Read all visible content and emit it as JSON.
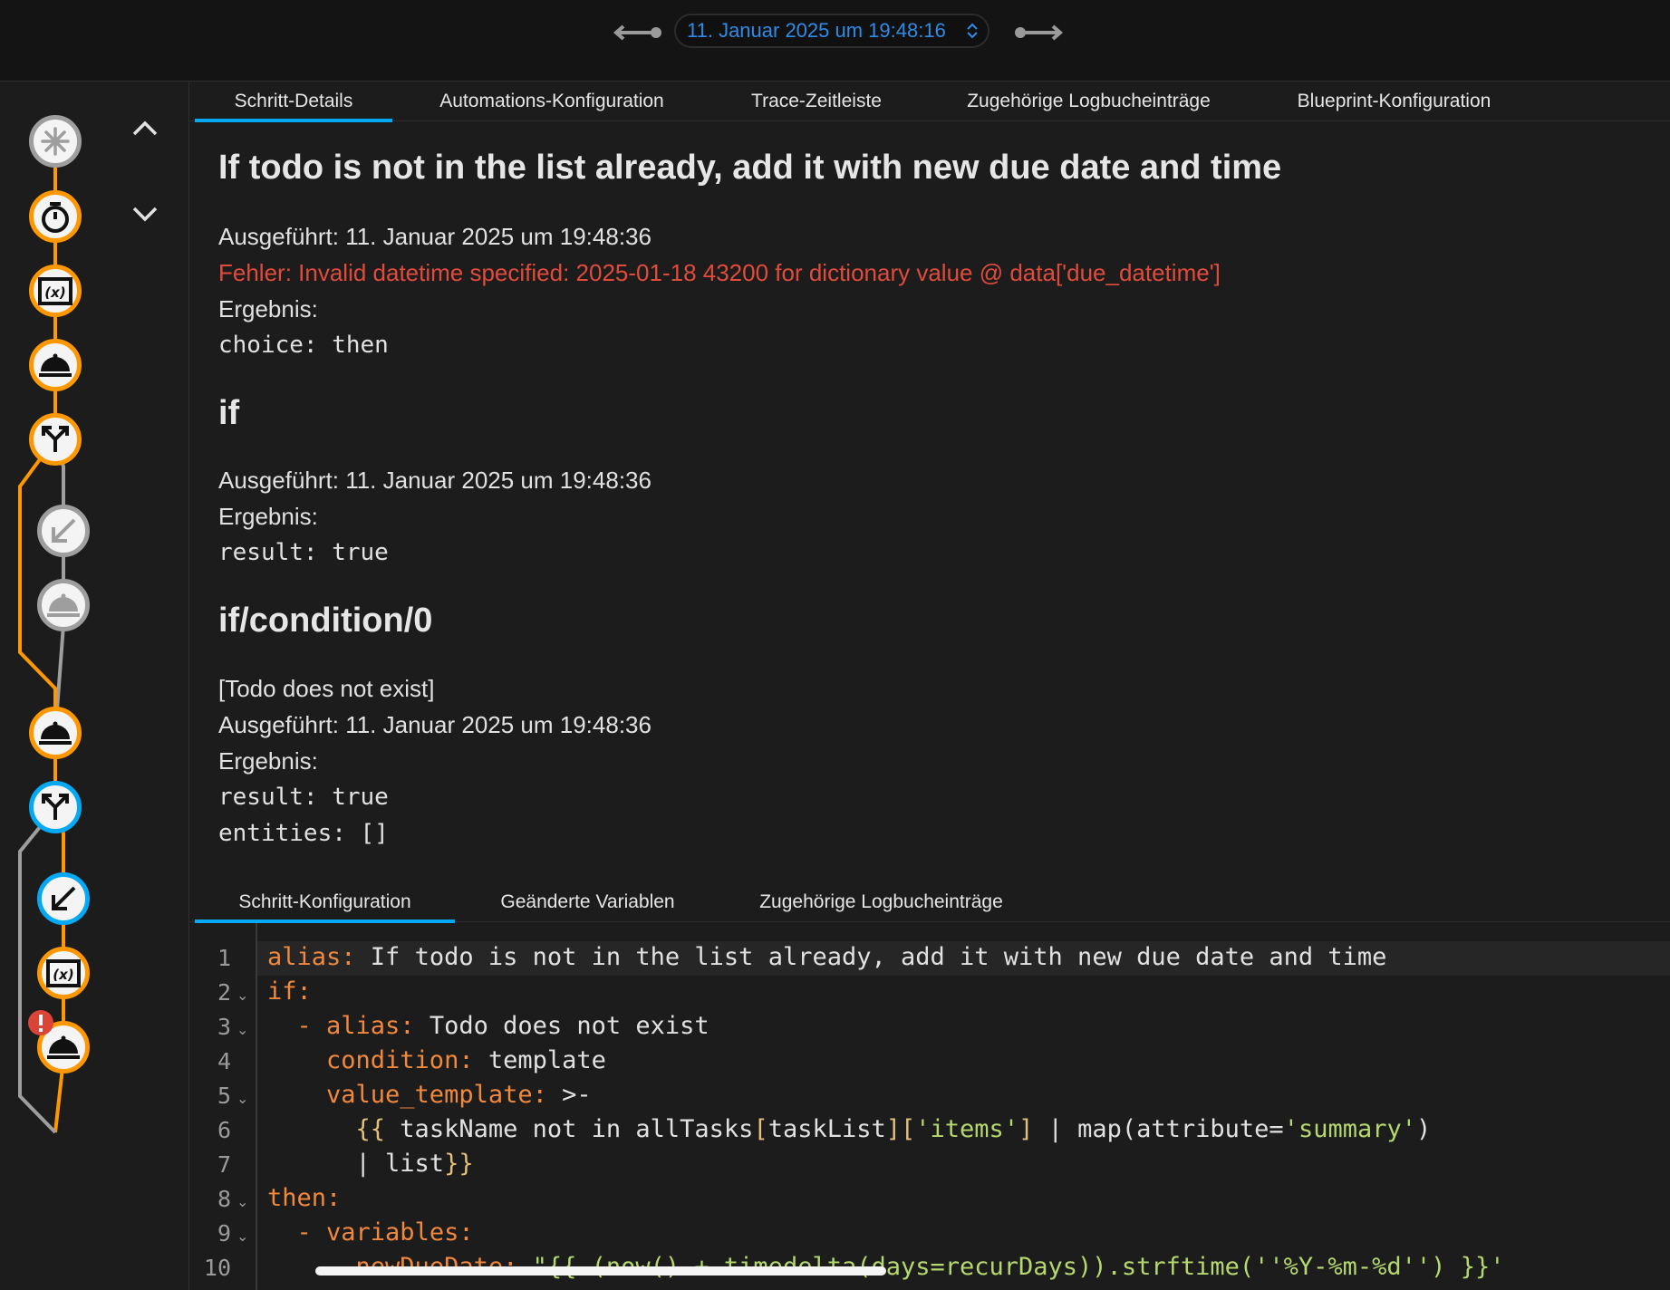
{
  "header": {
    "datetime": "11. Januar 2025 um 19:48:16"
  },
  "tabs_top": [
    "Schritt-Details",
    "Automations-Konfiguration",
    "Trace-Zeitleiste",
    "Zugehörige Logbucheinträge",
    "Blueprint-Konfiguration"
  ],
  "step": {
    "title": "If todo is not in the list already, add it with new due date and time",
    "executed": "Ausgeführt: 11. Januar 2025 um 19:48:36",
    "error": "Fehler: Invalid datetime specified: 2025-01-18 43200 for dictionary value @ data['due_datetime']",
    "result_label": "Ergebnis:",
    "result": "choice: then"
  },
  "section_if": {
    "title": "if",
    "executed": "Ausgeführt: 11. Januar 2025 um 19:48:36",
    "result_label": "Ergebnis:",
    "result": "result: true"
  },
  "section_cond": {
    "title": "if/condition/0",
    "alias": "[Todo does not exist]",
    "executed": "Ausgeführt: 11. Januar 2025 um 19:48:36",
    "result_label": "Ergebnis:",
    "result1": "result: true",
    "result2": "entities: []"
  },
  "tabs_bottom": [
    "Schritt-Konfiguration",
    "Geänderte Variablen",
    "Zugehörige Logbucheinträge"
  ],
  "code": {
    "line_numbers": [
      "1",
      "2",
      "3",
      "4",
      "5",
      "6",
      "7",
      "8",
      "9",
      "10"
    ],
    "l1_key": "alias:",
    "l1_val": " If todo is not in the list already, add it with new due date and time",
    "l2_key": "if:",
    "l3_dash": "  - ",
    "l3_key": "alias:",
    "l3_val": " Todo does not exist",
    "l4_key": "    condition:",
    "l4_val": " template",
    "l5_key": "    value_template:",
    "l5_val": " >-",
    "l6_open": "      {{",
    "l6_a": " taskName not in allTasks",
    "l6_b1": "[",
    "l6_c": "taskList",
    "l6_b2": "]",
    "l6_b3": "[",
    "l6_s1": "'items'",
    "l6_b4": "]",
    "l6_d": " | map(attribute=",
    "l6_s2": "'summary'",
    "l6_e": ")",
    "l7_a": "      | list",
    "l7_close": "}}",
    "l8_key": "then:",
    "l9_dash": "  - ",
    "l9_key": "variables:",
    "l10_key": "      newDueDate:",
    "l10_val": " \"{{ (now() + timedelta(days=recurDays)).strftime(''%Y-%m-%d'') }}'"
  },
  "colors": {
    "accent": "#03a9f4",
    "executed_path": "#ff9800",
    "error": "#e04b3c",
    "not_executed": "#9e9e9e"
  },
  "trace_nodes": [
    "trigger-icon",
    "timer-icon",
    "variables-icon",
    "service-icon",
    "choose-icon",
    "branch-icon",
    "service-icon",
    "service-icon",
    "choose-icon",
    "branch-icon",
    "variables-icon",
    "service-icon"
  ]
}
